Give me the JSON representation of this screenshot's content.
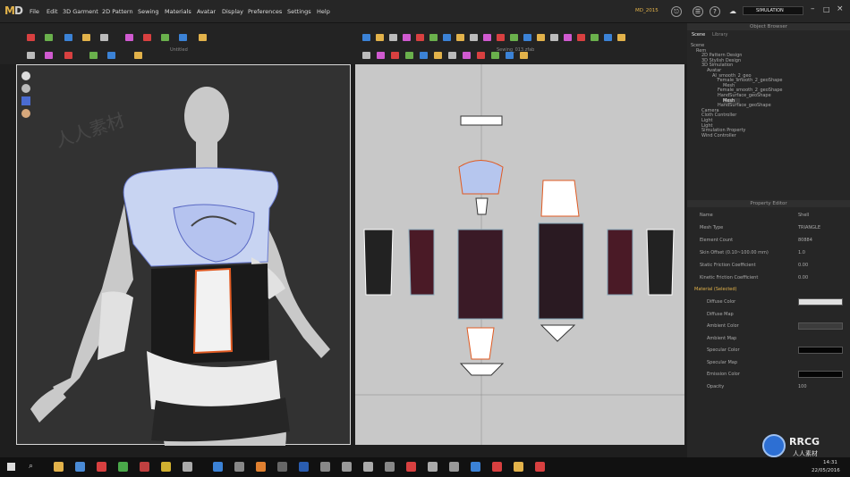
{
  "menu": {
    "items": [
      "File",
      "Edit",
      "3D Garment",
      "2D Pattern",
      "Sewing",
      "Materials",
      "Avatar",
      "Display",
      "Preferences",
      "Settings",
      "Help"
    ]
  },
  "titlebar": {
    "user_badge": "MD_2015",
    "mode": "SIMULATION"
  },
  "viewports": {
    "left_title": "Untitled",
    "right_title": "Sewing_013.zfab"
  },
  "object_browser": {
    "title": "Object Browser",
    "tabs": [
      "Scene",
      "Library"
    ],
    "tree": [
      {
        "label": "Scene",
        "indent": 0
      },
      {
        "label": "Rem",
        "indent": 1
      },
      {
        "label": "2D Pattern Design",
        "indent": 2
      },
      {
        "label": "3D Stylish Design",
        "indent": 2
      },
      {
        "label": "3D Simulation",
        "indent": 2
      },
      {
        "label": "Avatar",
        "indent": 3
      },
      {
        "label": "AI_smooth_2_geo",
        "indent": 4
      },
      {
        "label": "Female_smooth_2_geoShape",
        "indent": 5
      },
      {
        "label": "Mesh",
        "indent": 6
      },
      {
        "label": "Female_smooth_2_geoShape",
        "indent": 5
      },
      {
        "label": "HandSurface_geoShape",
        "indent": 5
      },
      {
        "label": "Mesh",
        "indent": 6,
        "selected": true
      },
      {
        "label": "HandSurface_geoShape",
        "indent": 5
      },
      {
        "label": "Camera",
        "indent": 2
      },
      {
        "label": "Cloth Controller",
        "indent": 2
      },
      {
        "label": "Light",
        "indent": 2
      },
      {
        "label": "Light",
        "indent": 2
      },
      {
        "label": "Simulation Property",
        "indent": 2
      },
      {
        "label": "Wind Controller",
        "indent": 2
      }
    ]
  },
  "property_editor": {
    "title": "Property Editor",
    "rows": [
      {
        "label": "Name",
        "value": "Shell"
      },
      {
        "label": "Mesh Type",
        "value": "TRIANGLE"
      },
      {
        "label": "Element Count",
        "value": "80884"
      },
      {
        "label": "Skin Offset (0.10~100.00 mm)",
        "value": "1.0"
      },
      {
        "label": "Static Friction Coefficient",
        "value": "0.00"
      },
      {
        "label": "Kinetic Friction Coefficient",
        "value": "0.00"
      }
    ],
    "material_header": "Material (Selected)",
    "material_rows": [
      {
        "label": "Diffuse Color",
        "swatch": "#e0e0e0"
      },
      {
        "label": "Diffuse Map"
      },
      {
        "label": "Ambient Color",
        "swatch": "#3c3c3c"
      },
      {
        "label": "Ambient Map"
      },
      {
        "label": "Specular Color",
        "swatch": "#050505"
      },
      {
        "label": "Specular Map"
      },
      {
        "label": "Emission Color",
        "swatch": "#050505"
      },
      {
        "label": "Opacity",
        "value": "100"
      }
    ]
  },
  "watermark": {
    "brand": "RRCG",
    "subtitle": "人人素材",
    "text": "人人素材"
  },
  "taskbar": {
    "time": "14:31",
    "date": "22/05/2016"
  },
  "colors": {
    "accent": "#e2b24a",
    "panel": "#262626",
    "pattern_bg": "#c8c8c8"
  }
}
